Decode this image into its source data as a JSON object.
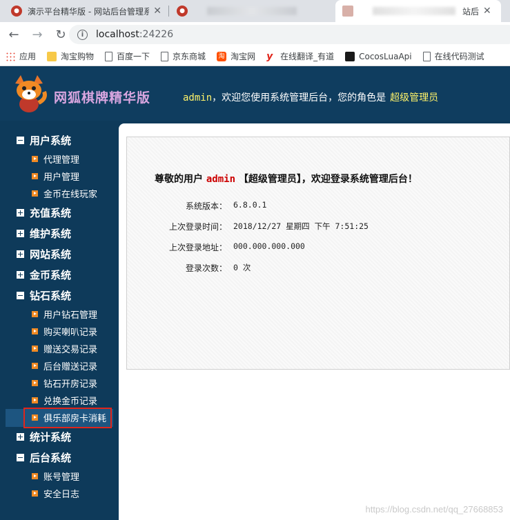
{
  "browser": {
    "tabs": [
      {
        "title": "演示平台精华版 - 网站后台管理系"
      },
      {
        "title": ""
      },
      {
        "title": "站后"
      }
    ],
    "url_host": "localhost",
    "url_port": ":24226",
    "bookmarks": [
      {
        "label": "应用",
        "icon": "apps-icon"
      },
      {
        "label": "淘宝购物",
        "icon": "folder-icon"
      },
      {
        "label": "百度一下",
        "icon": "page-icon"
      },
      {
        "label": "京东商城",
        "icon": "page-icon"
      },
      {
        "label": "淘宝网",
        "icon": "taobao-icon"
      },
      {
        "label": "在线翻译_有道",
        "icon": "youdao-icon"
      },
      {
        "label": "CocosLuaApi",
        "icon": "cocos-icon"
      },
      {
        "label": "在线代码测试",
        "icon": "page-icon"
      }
    ]
  },
  "header": {
    "brand": "网狐棋牌精华版",
    "username": "admin",
    "welcome_mid": "，欢迎您使用系统管理后台，您的角色是",
    "role": "超级管理员"
  },
  "sidebar": {
    "groups": [
      {
        "label": "用户系统",
        "expanded": true,
        "items": [
          "代理管理",
          "用户管理",
          "金币在线玩家"
        ]
      },
      {
        "label": "充值系统",
        "expanded": false,
        "items": []
      },
      {
        "label": "维护系统",
        "expanded": false,
        "items": []
      },
      {
        "label": "网站系统",
        "expanded": false,
        "items": []
      },
      {
        "label": "金币系统",
        "expanded": false,
        "items": []
      },
      {
        "label": "钻石系统",
        "expanded": true,
        "items": [
          "用户钻石管理",
          "购买喇叭记录",
          "赠送交易记录",
          "后台赠送记录",
          "钻石开房记录",
          "兑换金币记录",
          "俱乐部房卡消耗"
        ]
      },
      {
        "label": "统计系统",
        "expanded": false,
        "items": []
      },
      {
        "label": "后台系统",
        "expanded": true,
        "items": [
          "账号管理",
          "安全日志"
        ]
      }
    ]
  },
  "main": {
    "greeting_prefix": "尊敬的用户",
    "greeting_user": "admin",
    "greeting_suffix": "【超级管理员】，欢迎登录系统管理后台！",
    "rows": [
      {
        "label": "系统版本：",
        "value": "6.8.0.1"
      },
      {
        "label": "上次登录时间：",
        "value": "2018/12/27 星期四 下午 7:51:25"
      },
      {
        "label": "上次登录地址：",
        "value": "000.000.000.000"
      },
      {
        "label": "登录次数：",
        "value": "0 次"
      }
    ]
  },
  "watermark": "https://blog.csdn.net/qq_27668853",
  "colors": {
    "nav_bg": "#0e3a5a",
    "highlight": "#e1251b",
    "accent_yellow": "#fff36a",
    "bullet_orange": "#f08a24"
  }
}
